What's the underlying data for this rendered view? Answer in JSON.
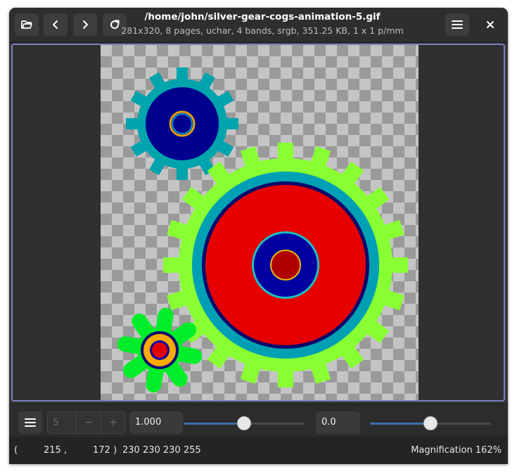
{
  "header": {
    "title": "/home/john/silver-gear-cogs-animation-5.gif",
    "subtitle": "281x320, 8 pages,  uchar, 4 bands, srgb, 351.25 KB, 1 x 1 p/mm"
  },
  "toolbar": {
    "page_value": "5",
    "minus": "−",
    "plus": "+",
    "scale_value": "1.000",
    "scale_slider": 0.5,
    "offset_value": "0.0",
    "offset_slider": 0.5
  },
  "status": {
    "open_paren": "(",
    "x": "215",
    "comma": ",",
    "y": "172",
    "close_paren": ")",
    "pixel": "230 230 230 255",
    "magnification": "Magnification 162%"
  },
  "icons": {
    "open": "folder-open-icon",
    "prev": "go-previous-icon",
    "next": "go-next-icon",
    "reload": "reload-icon",
    "menu": "hamburger-menu-icon",
    "close": "close-icon"
  },
  "colors": {
    "accent": "#7b7fbf",
    "slider_fill": "#3f6ea8"
  }
}
